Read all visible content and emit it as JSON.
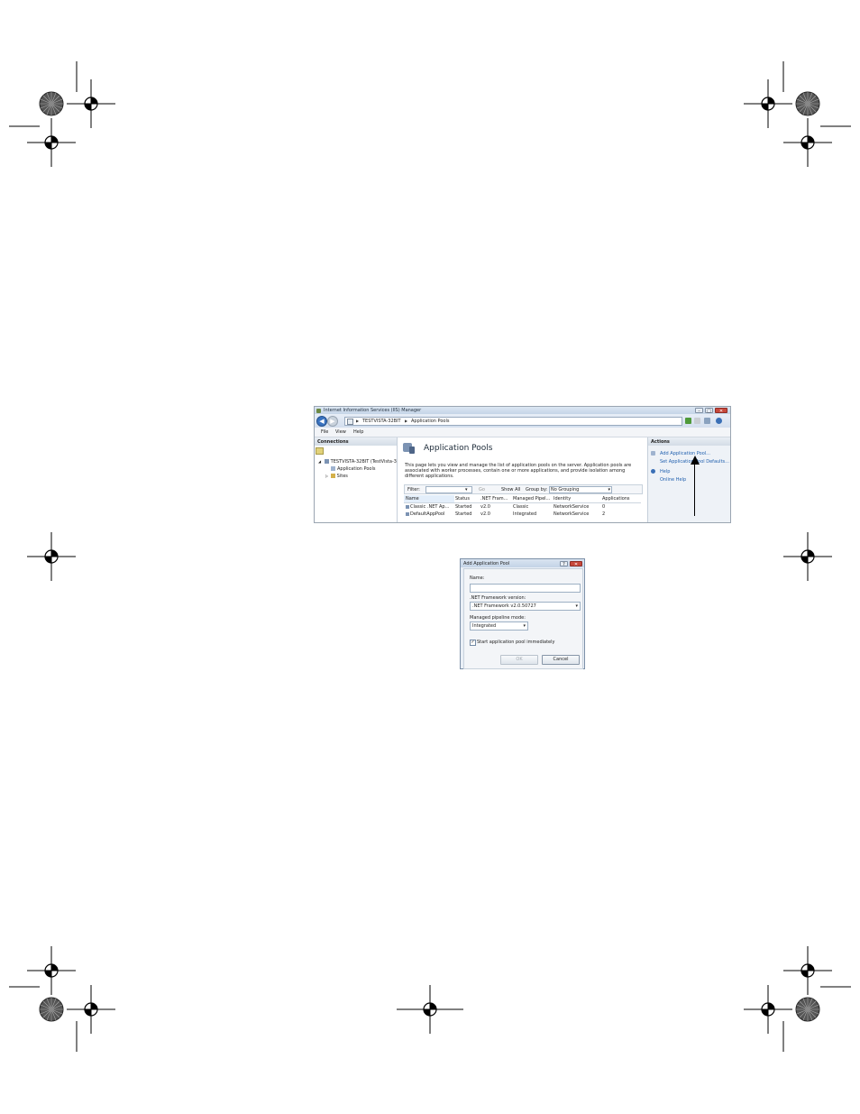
{
  "window": {
    "title": "Internet Information Services (IIS) Manager",
    "controls": {
      "minimize": "–",
      "maximize": "□",
      "close": "✕"
    }
  },
  "nav": {
    "back": "◀",
    "forward": "▶",
    "breadcrumb": [
      "TESTVISTA-32BIT",
      "Application Pools"
    ],
    "separator": "▶"
  },
  "toolbar_icons": [
    "refresh-icon",
    "stop-icon",
    "connect-icon",
    "help-icon"
  ],
  "menu": [
    "File",
    "View",
    "Help"
  ],
  "connections": {
    "header": "Connections",
    "tree": [
      {
        "label": "TESTVISTA-32BIT (TestVista-3",
        "expander": "◢"
      },
      {
        "label": "Application Pools"
      },
      {
        "label": "Sites",
        "expander": "▷"
      }
    ]
  },
  "main": {
    "title": "Application Pools",
    "description": "This page lets you view and manage the list of application pools on the server. Application pools are associated with worker processes, contain one or more applications, and provide isolation among different applications.",
    "filter": {
      "label": "Filter:",
      "go_label": "Go",
      "show_all_label": "Show All",
      "group_by_label": "Group by:",
      "group_by_value": "No Grouping",
      "dropdown_arrow": "▾"
    },
    "columns": [
      "Name",
      "Status",
      ".NET Fram...",
      "Managed Pipel...",
      "Identity",
      "Applications"
    ],
    "rows": [
      [
        "Classic .NET Ap...",
        "Started",
        "v2.0",
        "Classic",
        "NetworkService",
        "0"
      ],
      [
        "DefaultAppPool",
        "Started",
        "v2.0",
        "Integrated",
        "NetworkService",
        "2"
      ]
    ]
  },
  "actions": {
    "header": "Actions",
    "items": [
      "Add Application Pool...",
      "Set Application Pool Defaults...",
      "Help",
      "Online Help"
    ]
  },
  "dialog": {
    "title": "Add Application Pool",
    "help_button": "?",
    "close_button": "✕",
    "name_label": "Name:",
    "name_value": "",
    "framework_label": ".NET Framework version:",
    "framework_value": ".NET Framework v2.0.50727",
    "pipeline_label": "Managed pipeline mode:",
    "pipeline_value": "Integrated",
    "start_checkbox_label": "Start application pool immediately",
    "start_checked": true,
    "check_glyph": "✓",
    "select_arrow": "▾",
    "ok_label": "OK",
    "cancel_label": "Cancel"
  },
  "colors": {
    "link": "#1f5fae",
    "titlebar": "#c5d5e8",
    "close_button": "#c7483c",
    "selection": "#e3eefa"
  }
}
